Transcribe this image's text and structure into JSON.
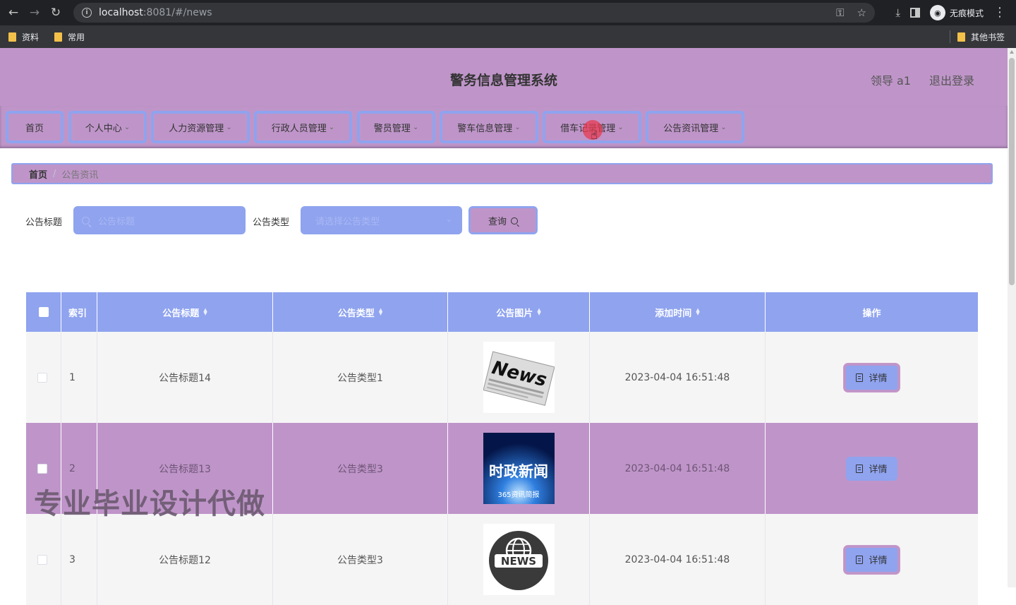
{
  "browser": {
    "url_host": "localhost",
    "url_rest": ":8081/#/news",
    "incognito_label": "无痕模式",
    "bookmarks": [
      "资料",
      "常用"
    ],
    "other_bookmarks": "其他书签"
  },
  "header": {
    "title": "警务信息管理系统",
    "user": "领导 a1",
    "logout": "退出登录"
  },
  "menu": {
    "items": [
      {
        "label": "首页",
        "dropdown": false
      },
      {
        "label": "个人中心",
        "dropdown": true
      },
      {
        "label": "人力资源管理",
        "dropdown": true
      },
      {
        "label": "行政人员管理",
        "dropdown": true
      },
      {
        "label": "警员管理",
        "dropdown": true
      },
      {
        "label": "警车信息管理",
        "dropdown": true
      },
      {
        "label": "借车记录管理",
        "dropdown": true
      },
      {
        "label": "公告资讯管理",
        "dropdown": true
      }
    ]
  },
  "breadcrumb": {
    "home": "首页",
    "current": "公告资讯"
  },
  "search": {
    "title_label": "公告标题",
    "title_placeholder": "公告标题",
    "type_label": "公告类型",
    "type_placeholder": "请选择公告类型",
    "query_label": "查询"
  },
  "table": {
    "columns": [
      "索引",
      "公告标题",
      "公告类型",
      "公告图片",
      "添加时间",
      "操作"
    ],
    "rows": [
      {
        "index": "1",
        "title": "公告标题14",
        "type": "公告类型1",
        "image": "news-paper",
        "time": "2023-04-04 16:51:48",
        "action": "详情"
      },
      {
        "index": "2",
        "title": "公告标题13",
        "type": "公告类型3",
        "image": "news-political",
        "image_text": "时政新闻",
        "image_subtext": "365资讯简报",
        "time": "2023-04-04 16:51:48",
        "action": "详情"
      },
      {
        "index": "3",
        "title": "公告标题12",
        "type": "公告类型3",
        "image": "news-globe",
        "image_text": "NEWS",
        "time": "2023-04-04 16:51:48",
        "action": "详情"
      }
    ]
  },
  "watermark": "专业毕业设计代做",
  "colors": {
    "header_bg": "#bf95c9",
    "accent_blue": "#8fa3ef"
  }
}
